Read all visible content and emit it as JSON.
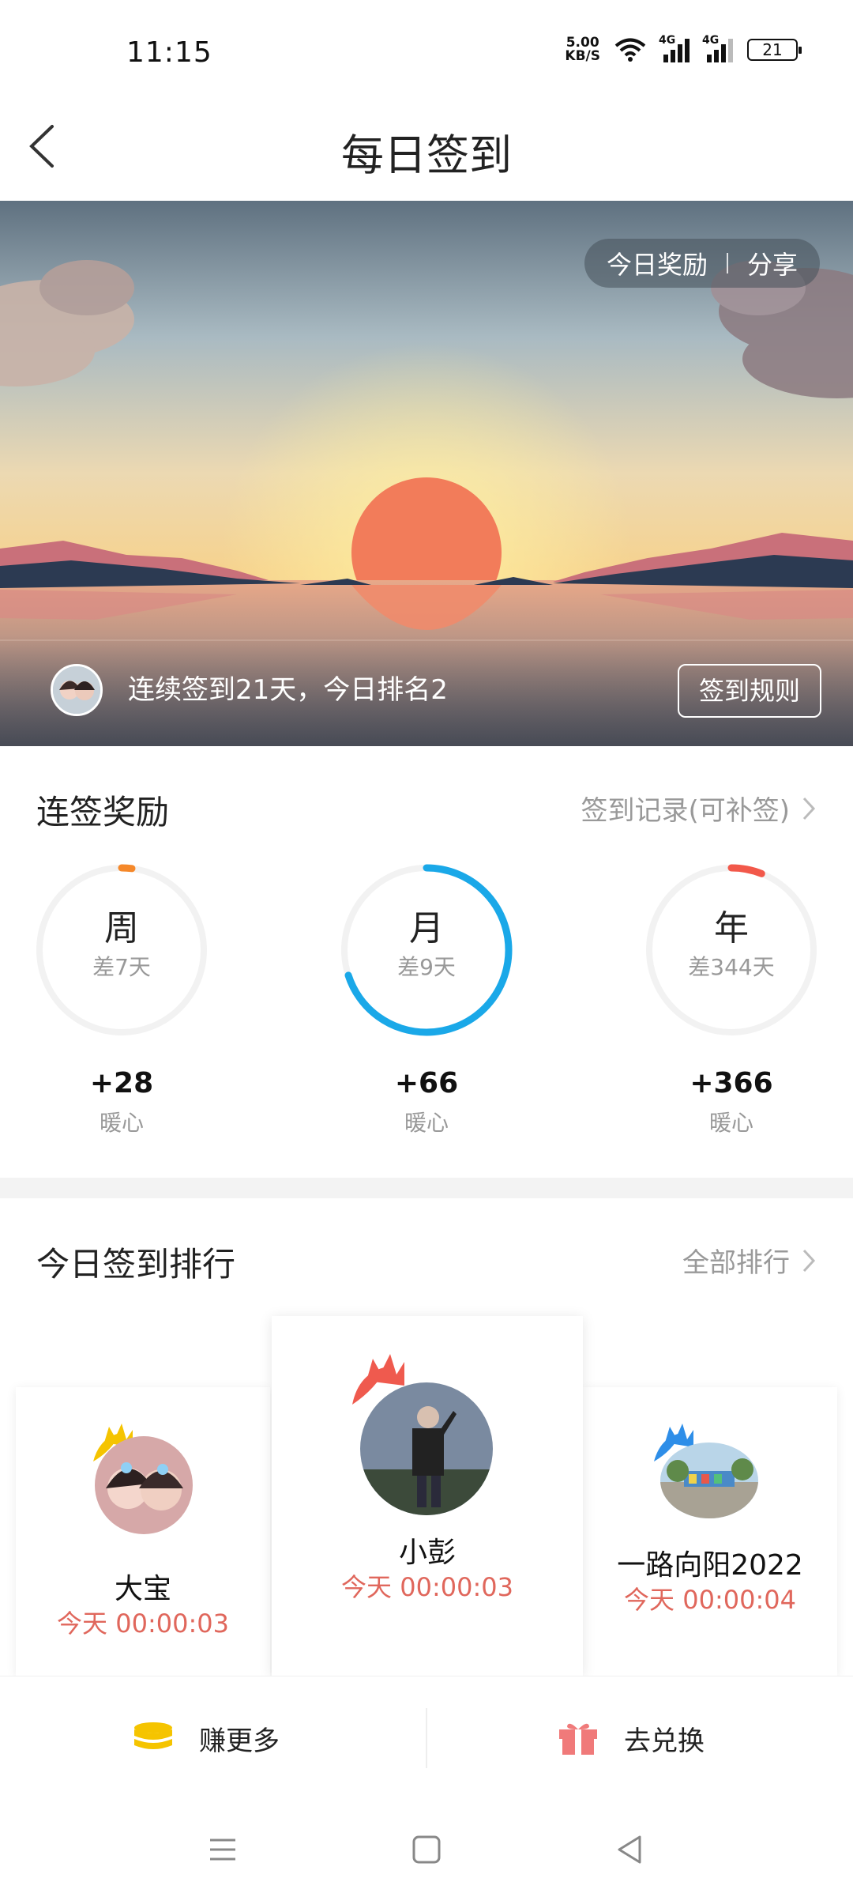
{
  "status": {
    "time": "11:15",
    "net_speed_top": "5.00",
    "net_speed_bottom": "KB/S",
    "sim1": "4G",
    "sim2": "4G",
    "battery": "21"
  },
  "header": {
    "title": "每日签到"
  },
  "banner": {
    "reward_label": "今日奖励",
    "share_label": "分享",
    "streak_text": "连续签到21天，今日排名2",
    "rules_label": "签到规则"
  },
  "streak": {
    "title": "连签奖励",
    "record_link": "签到记录(可补签)",
    "rings": [
      {
        "label": "周",
        "remaining": "差7天",
        "amount": "+28",
        "unit": "暖心",
        "progress": 0.02,
        "color": "#f5882a"
      },
      {
        "label": "月",
        "remaining": "差9天",
        "amount": "+66",
        "unit": "暖心",
        "progress": 0.7,
        "color": "#1aa8e8"
      },
      {
        "label": "年",
        "remaining": "差344天",
        "amount": "+366",
        "unit": "暖心",
        "progress": 0.06,
        "color": "#f2584a"
      }
    ]
  },
  "ranking": {
    "title": "今日签到排行",
    "all_link": "全部排行",
    "entries": [
      {
        "name": "小彭",
        "time": "今天 00:00:03"
      },
      {
        "name": "大宝",
        "time": "今天 00:00:03"
      },
      {
        "name": "一路向阳2022",
        "time": "今天 00:00:04"
      }
    ]
  },
  "bottom": {
    "earn_label": "赚更多",
    "exchange_label": "去兑换"
  },
  "colors": {
    "accent_red": "#e0675c",
    "gold": "#f5c400",
    "blue": "#1aa8e8"
  }
}
